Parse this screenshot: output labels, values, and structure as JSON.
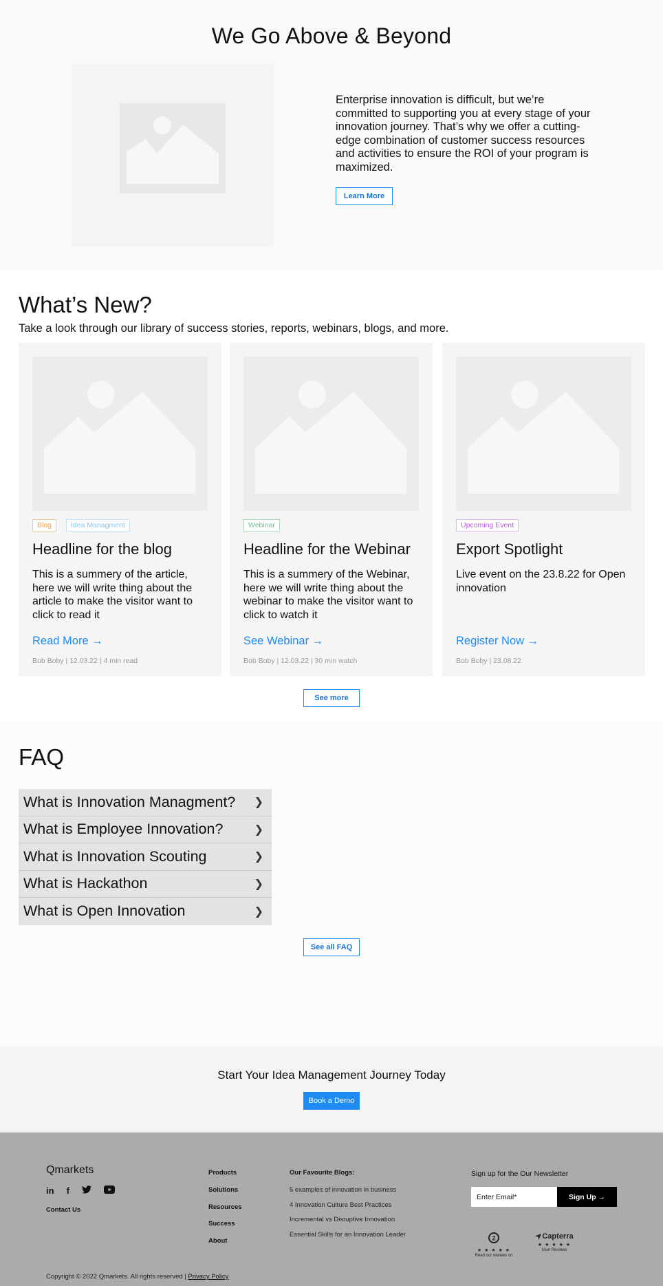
{
  "above": {
    "title": "We Go Above & Beyond",
    "text": "Enterprise innovation is difficult, but we’re committed to supporting you at every stage of your innovation journey. That’s why we offer a cutting-edge combination of customer success resources and activities to ensure the ROI of your program is maximized.",
    "button": "Learn More"
  },
  "whats_new": {
    "title": "What’s New?",
    "subtitle": "Take a look through our library of success stories, reports, webinars, blogs, and more.",
    "cards": [
      {
        "tags": [
          {
            "label": "Blog",
            "color": "#f0a04b"
          },
          {
            "label": "Idea Managment",
            "color": "#8cc3f0"
          }
        ],
        "title": "Headline for the blog",
        "summary": "This is a summery of the article, here we will write thing about the article to make the visitor want to click to read it",
        "link": "Read More →",
        "meta": "Bob Boby | 12.03.22 | 4 min read"
      },
      {
        "tags": [
          {
            "label": "Webinar",
            "color": "#6cc08a"
          }
        ],
        "title": "Headline for the Webinar",
        "summary": "This is a summery of the Webinar, here we will write thing about the webinar to make the visitor want to click to watch it",
        "link": "See Webinar →",
        "meta": "Bob Boby | 12.03.22 | 30 min watch"
      },
      {
        "tags": [
          {
            "label": "Upcoming Event",
            "color": "#b65be0"
          }
        ],
        "title": "Export Spotlight",
        "summary": "Live event on the 23.8.22 for Open innovation",
        "link": "Register Now →",
        "meta": "Bob Boby | 23.08.22"
      }
    ],
    "see_more": "See more"
  },
  "faq": {
    "title": "FAQ",
    "items": [
      "What is Innovation Managment?",
      "What is Employee Innovation?",
      "What is Innovation Scouting",
      "What is Hackathon",
      "What is Open Innovation"
    ],
    "see_all": "See all FAQ"
  },
  "cta": {
    "text": "Start Your Idea Management Journey Today",
    "button": "Book a Demo"
  },
  "footer": {
    "logo": "Qmarkets",
    "social": [
      "in",
      "f",
      "twitter",
      "youtube"
    ],
    "contact": "Contact Us",
    "nav": [
      "Products",
      "Solutions",
      "Resources",
      "Success",
      "About"
    ],
    "blogs_heading": "Our Favourite Blogs:",
    "blogs": [
      "5 examples of innovation in business",
      "4 Innovation Culture Best Practices",
      "Incremental vs Disruptive Innovation",
      "Essential Skills for an Innovation Leader"
    ],
    "newsletter_label": "Sign up for the Our Newsletter",
    "email_placeholder": "Enter Email*",
    "signup": "Sign Up →",
    "g2_caption": "Read our reviews on",
    "g2_stars": "★ ★ ★ ★ ★",
    "capterra_name": "Capterra",
    "capterra_stars": "★ ★ ★ ★ ★",
    "capterra_caption": "User Reviews",
    "copyright": "Copyright © 2022 Qmarkets. All rights reserved |",
    "privacy": "Privacy Policy"
  }
}
